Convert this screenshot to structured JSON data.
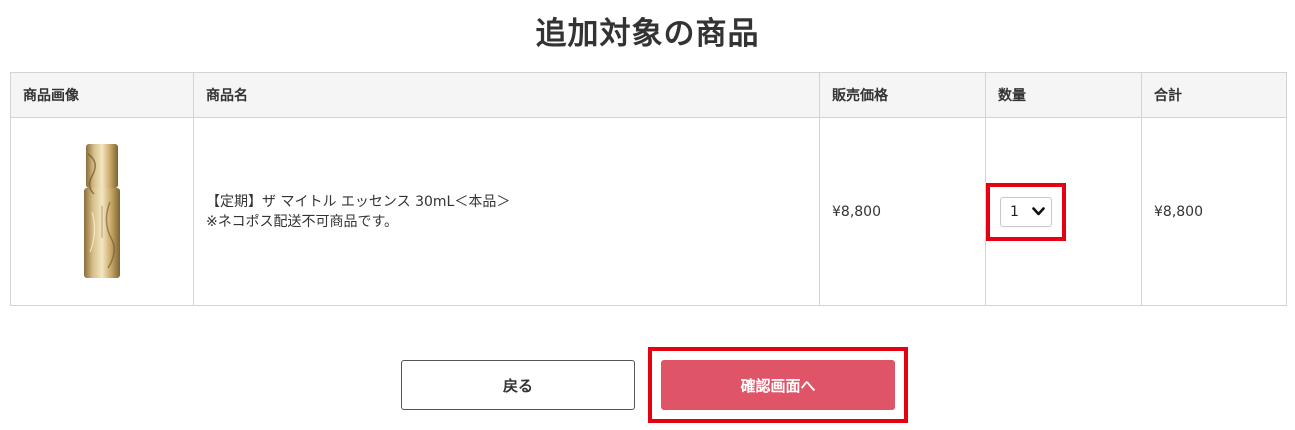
{
  "page": {
    "title": "追加対象の商品"
  },
  "table": {
    "headers": {
      "image": "商品画像",
      "name": "商品名",
      "price": "販売価格",
      "quantity": "数量",
      "total": "合計"
    },
    "rows": [
      {
        "name_line1": "【定期】ザ マイトル エッセンス 30mL＜本品＞",
        "name_line2": "※ネコポス配送不可商品です。",
        "price": "¥8,800",
        "quantity": "1",
        "total": "¥8,800"
      }
    ]
  },
  "buttons": {
    "back": "戻る",
    "confirm": "確認画面へ"
  },
  "colors": {
    "accent": "#e05468",
    "highlight": "#e60012",
    "header_bg": "#f5f5f5",
    "border": "#d4d4d4"
  }
}
